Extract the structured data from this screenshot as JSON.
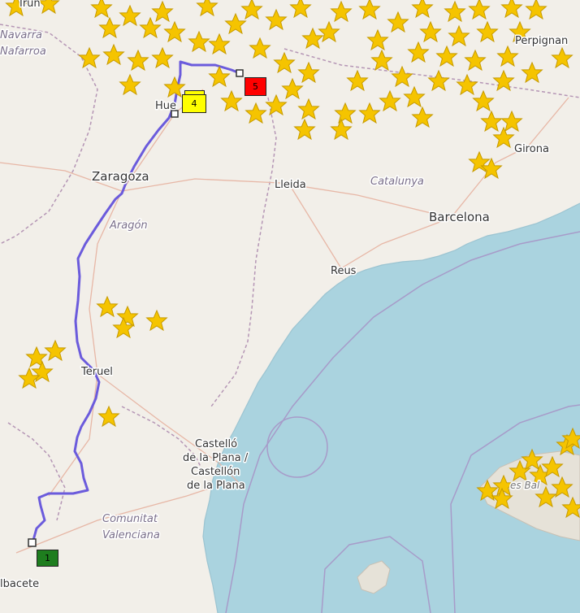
{
  "labels": {
    "irun": "Irun",
    "navarra": "Navarra",
    "nafarroa": "Nafarroa",
    "perpignan": "Perpignan",
    "huesca": "Hue",
    "zaragoza": "Zaragoza",
    "lleida": "Lleida",
    "catalunya": "Catalunya",
    "girona": "Girona",
    "aragon": "Aragón",
    "barcelona": "Barcelona",
    "reus": "Reus",
    "teruel": "Teruel",
    "castello1": "Castelló",
    "castello2": "de la Plana /",
    "castello3": "Castellón",
    "castello4": "de la Plana",
    "comunitat": "Comunitat",
    "valenciana": "Valenciana",
    "albacete": "lbacete",
    "illes": "es Bal"
  },
  "markers": [
    {
      "id": "1",
      "label": "1",
      "color": "#1e7d1e",
      "text_color": "#000000"
    },
    {
      "id": "4",
      "label": "4",
      "color": "#ffff00",
      "text_color": "#000000"
    },
    {
      "id": "5",
      "label": "5",
      "color": "#ff0000",
      "text_color": "#000000"
    }
  ],
  "colors": {
    "route": "#6b5bdc",
    "sea": "#aad3df",
    "land": "#f2efe9",
    "star": "#f5c400",
    "border": "#b596b5"
  },
  "icons": {
    "star": "star-icon",
    "waypoint": "waypoint-square-icon"
  }
}
